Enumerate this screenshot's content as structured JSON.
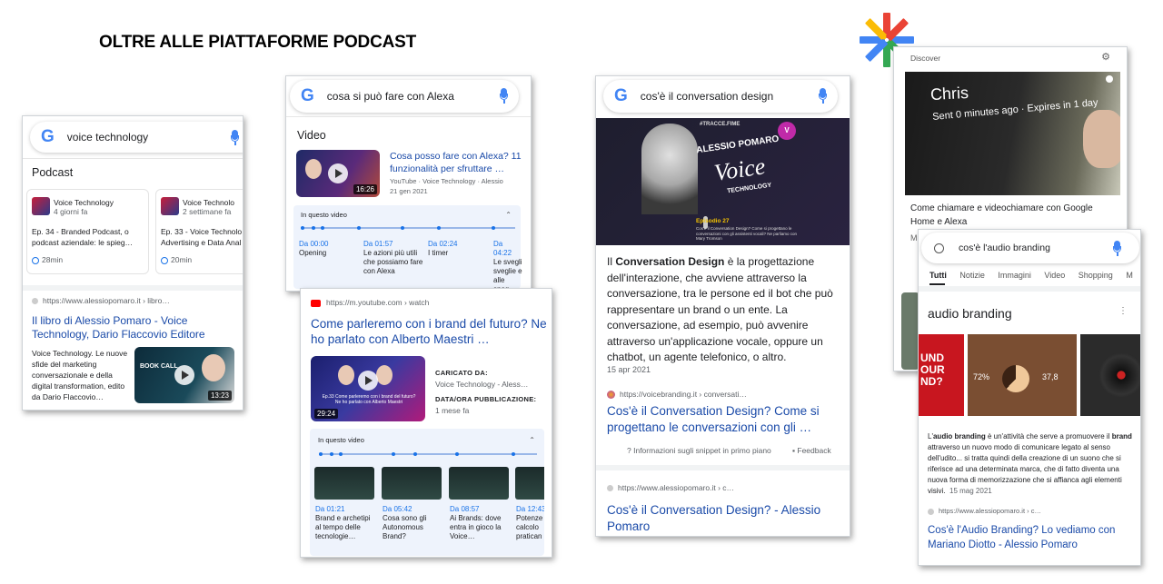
{
  "title": "OLTRE ALLE PIATTAFORME PODCAST",
  "card1": {
    "query": "voice technology",
    "section": "Podcast",
    "ep1": {
      "show": "Voice Technology",
      "ago": "4 giorni fa",
      "title": "Ep. 34 - Branded Podcast, o podcast aziendale: le spieg…",
      "dur": "28min"
    },
    "ep2": {
      "show": "Voice Technolo",
      "ago": "2 settimane fa",
      "title": "Ep. 33 - Voice Technolo Advertising e Data Anal",
      "dur": "20min"
    },
    "url": "https://www.alessiopomaro.it › libro…",
    "result_title": "Il libro di Alessio Pomaro - Voice Technology, Dario Flaccovio Editore",
    "snippet": "Voice Technology. Le nuove sfide del marketing conversazionale e della digital transformation, edito da Dario Flaccovio…",
    "thumb_text": "BOOK CALL",
    "thumb_dur": "13:23"
  },
  "card2": {
    "query": "cosa si può fare con Alexa",
    "section": "Video",
    "video_title": "Cosa posso fare con Alexa? 11 funzionalità per sfruttare …",
    "video_meta": "YouTube · Voice Technology · Alessio",
    "video_date": "21 gen 2021",
    "video_dur": "16:26",
    "in_video": "In questo video",
    "chapters": [
      {
        "time": "Da 00:00",
        "text": "Opening"
      },
      {
        "time": "Da 01:57",
        "text": "Le azioni più utili che possiamo fare con Alexa"
      },
      {
        "time": "Da 02:24",
        "text": "I timer"
      },
      {
        "time": "Da 04:22",
        "text": "Le svegli sveglie e alle speg"
      }
    ]
  },
  "card3": {
    "url": "https://m.youtube.com › watch",
    "result_title": "Come parleremo con i brand del futuro? Ne ho parlato con Alberto Maestri …",
    "thumb_caption": "Ep.33 Come parleremo con i brand del futuro? Ne ho parlato con Alberto Maestri",
    "thumb_dur": "29:24",
    "uploaded_label": "CARICATO DA:",
    "uploaded_value": "Voice Technology - Aless…",
    "date_label": "DATA/ORA PUBBLICAZIONE:",
    "date_value": "1 mese fa",
    "in_video": "In questo video",
    "chapters": [
      {
        "time": "Da 01:21",
        "text": "Brand e archetipi al tempo delle tecnologie…"
      },
      {
        "time": "Da 05:42",
        "text": "Cosa sono gli Autonomous Brand?"
      },
      {
        "time": "Da 08:57",
        "text": "Ai Brands: dove entra in gioco la Voice…"
      },
      {
        "time": "Da 12:43",
        "text": "Potenze calcolo pratican"
      }
    ]
  },
  "card4": {
    "query": "cos'è il conversation design",
    "image_top": "#TRACCE.FIME",
    "image_name": "ALESSIO POMARO",
    "image_voice": "Voice",
    "image_tech": "TECHNOLOGY",
    "image_ep": "Episodio 27",
    "image_ep_desc": "Cos'è il Conversation Design? Come si progettano le conversazioni con gli assistenti vocali? Ne parliamo con Mary Tromson",
    "snippet_bold": "Conversation Design",
    "snippet_pre": "Il ",
    "snippet_post": " è la progettazione dell'interazione, che avviene attraverso la conversazione, tra le persone ed il bot che può rappresentare un brand o un ente. La conversazione, ad esempio, può avvenire attraverso un'applicazione vocale, oppure un chatbot, un agente telefonico, o altro.",
    "date": "15 apr 2021",
    "url1": "https://voicebranding.it › conversati…",
    "title1": "Cos'è il Conversation Design? Come si progettano le conversazioni con gli …",
    "info": "Informazioni sugli snippet in primo piano",
    "feedback": "Feedback",
    "url2": "https://www.alessiopomaro.it › c…",
    "title2": "Cos'è il Conversation Design? - Alessio Pomaro"
  },
  "card5": {
    "header": "Discover",
    "story_name": "Chris",
    "story_sub": "Sent 0 minutes ago · Expires in 1 day",
    "caption": "Come chiamare e videochiamare con Google Home e Alexa",
    "partial": "M"
  },
  "card6": {
    "query": "cos'è l'audio branding",
    "tabs": [
      "Tutti",
      "Notizie",
      "Immagini",
      "Video",
      "Shopping",
      "M"
    ],
    "heading": "audio branding",
    "img1_text": "UND OUR ND?",
    "img2_p1": "72%",
    "img2_p2": "37,8",
    "snippet_pre": "L'",
    "snippet_b1": "audio branding",
    "snippet_mid1": " è un'attività che serve a promuovere il ",
    "snippet_b2": "brand",
    "snippet_post": " attraverso un nuovo modo di comunicare legato al senso dell'udito... si tratta quindi della creazione di un suono che si riferisce ad una determinata marca, che di fatto diventa una nuova forma di memorizzazione che si affianca agli elementi visivi.",
    "date": "15 mag 2021",
    "url": "https://www.alessiopomaro.it › c…",
    "title": "Cos'è l'Audio Branding? Lo vediamo con Mariano Diotto - Alessio Pomaro"
  },
  "colors": {
    "google_blue": "#4285f4",
    "google_red": "#ea4335",
    "google_yellow": "#fbbc05",
    "google_green": "#34a853",
    "link": "#1a0dab"
  }
}
